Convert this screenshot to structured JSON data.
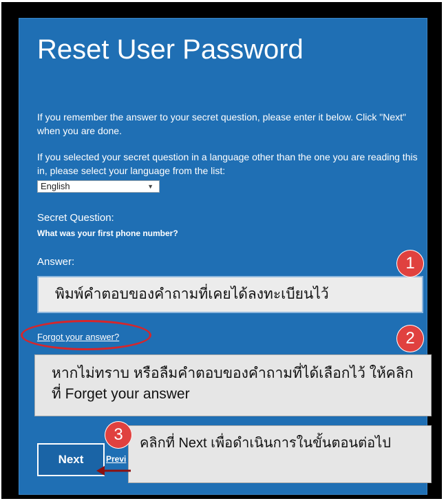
{
  "page": {
    "title": "Reset User Password",
    "intro_text": "If you remember the answer to your secret question, please enter it below. Click \"Next\" when you are done.",
    "language_text": "If you selected your secret question in a language other than the one you are reading this in, please select your language from the list:",
    "language_select": {
      "value": "English"
    },
    "secret_question_label": "Secret Question:",
    "secret_question": "What was your first phone number?",
    "answer_label": "Answer:",
    "answer_field_value": "พิมพ์คำตอบของคำถามที่เคยได้ลงทะเบียนไว้",
    "forgot_link": "Forgot your answer?",
    "next_button": "Next",
    "previous_link": "Previ"
  },
  "annotations": {
    "badge_1": "1",
    "badge_2": "2",
    "badge_3": "3",
    "callout_2": "หากไม่ทราบ หรือลืมคำตอบของคำถามที่ได้เลือกไว้ ให้คลิกที่ Forget your answer",
    "callout_3": "คลิกที่ Next เพื่อดำเนินการในขั้นตอนต่อไป",
    "highlight_color": "#d6262b",
    "badge_color": "#e0413f"
  },
  "colors": {
    "panel_background": "#1f6fb4",
    "frame": "#000000"
  }
}
